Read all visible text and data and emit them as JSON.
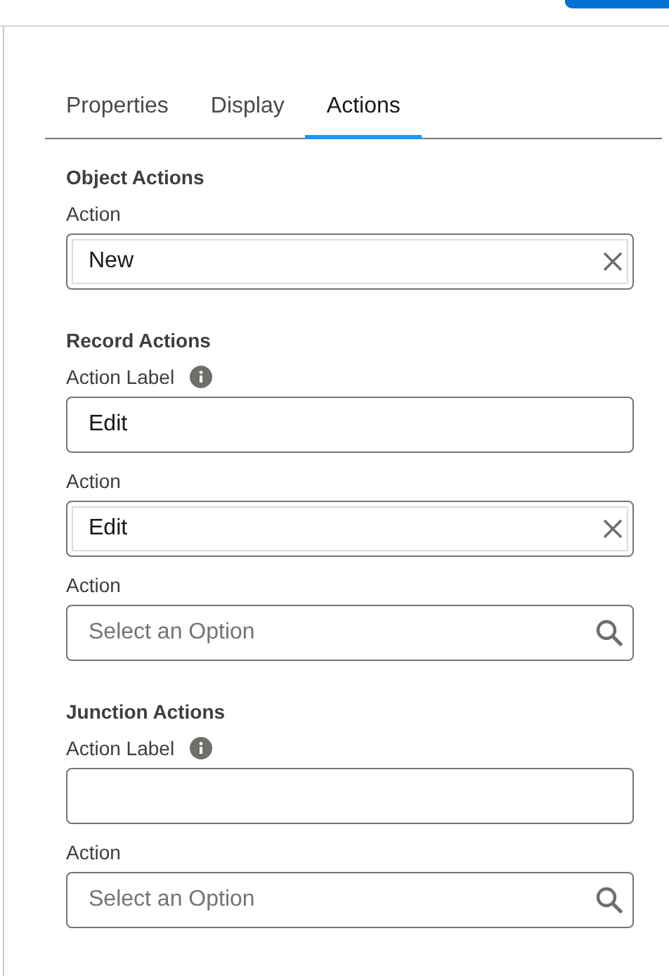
{
  "tabs": [
    {
      "label": "Properties",
      "selected": false
    },
    {
      "label": "Display",
      "selected": false
    },
    {
      "label": "Actions",
      "selected": true
    }
  ],
  "sections": [
    {
      "title": "Object Actions",
      "fields": [
        {
          "label": "Action",
          "info": false,
          "kind": "combo",
          "value": "New"
        }
      ]
    },
    {
      "title": "Record Actions",
      "fields": [
        {
          "label": "Action Label",
          "info": true,
          "kind": "text",
          "value": "Edit"
        },
        {
          "label": "Action",
          "info": false,
          "kind": "combo",
          "value": "Edit"
        },
        {
          "label": "Action",
          "info": false,
          "kind": "search",
          "placeholder": "Select an Option"
        }
      ]
    },
    {
      "title": "Junction Actions",
      "fields": [
        {
          "label": "Action Label",
          "info": true,
          "kind": "text"
        },
        {
          "label": "Action",
          "info": false,
          "kind": "search",
          "placeholder": "Select an Option"
        }
      ]
    }
  ]
}
